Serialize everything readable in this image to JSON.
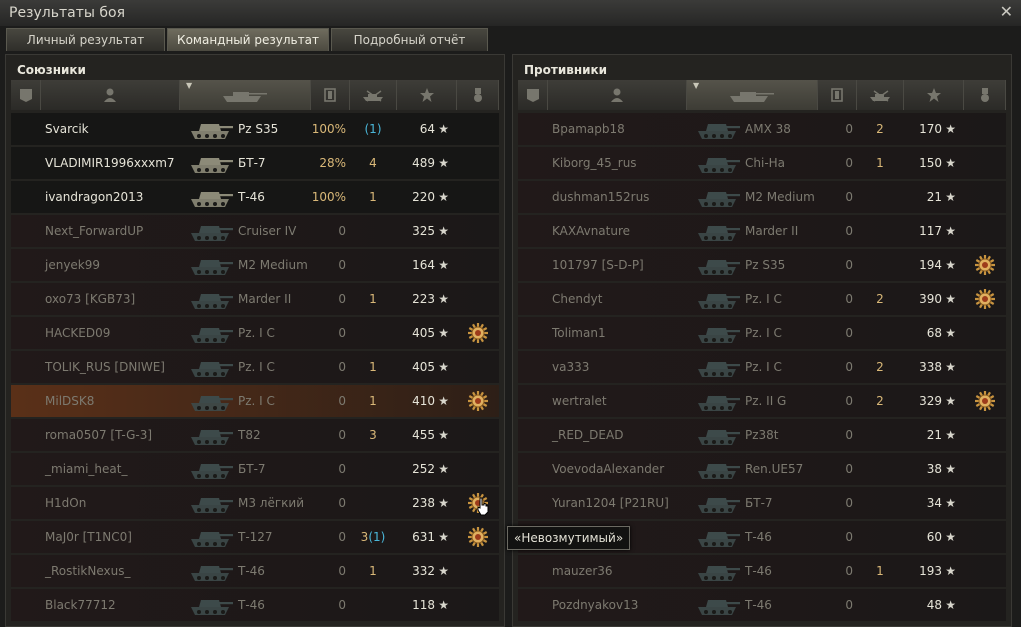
{
  "window": {
    "title": "Результаты боя",
    "close_icon": "close-icon"
  },
  "tabs": [
    {
      "label": "Личный результат",
      "active": false
    },
    {
      "label": "Командный результат",
      "active": true
    },
    {
      "label": "Подробный отчёт",
      "active": false
    }
  ],
  "columns": [
    "squad-icon",
    "player-icon",
    "tank-icon",
    "damage-icon",
    "kills-icon",
    "xp-icon",
    "medal-icon"
  ],
  "allies": {
    "title": "Союзники",
    "rows": [
      {
        "name": "Svarcik",
        "tank": "Pz S35",
        "dmg": "100%",
        "kills_main": "",
        "kills_blue": "(1)",
        "xp": "64",
        "medal": false,
        "state": "alive",
        "dmg_hi": true
      },
      {
        "name": "VLADIMIR1996xxxm7",
        "tank": "БТ-7",
        "dmg": "28%",
        "kills_main": "4",
        "kills_blue": "",
        "xp": "489",
        "medal": false,
        "state": "alive",
        "dmg_hi": true
      },
      {
        "name": "ivandragon2013",
        "tank": "Т-46",
        "dmg": "100%",
        "kills_main": "1",
        "kills_blue": "",
        "xp": "220",
        "medal": false,
        "state": "alive",
        "dmg_hi": true
      },
      {
        "name": "Next_ForwardUP",
        "tank": "Cruiser IV",
        "dmg": "0",
        "kills_main": "",
        "kills_blue": "",
        "xp": "325",
        "medal": false,
        "state": "dead"
      },
      {
        "name": "jenyek99",
        "tank": "M2 Medium",
        "dmg": "0",
        "kills_main": "",
        "kills_blue": "",
        "xp": "164",
        "medal": false,
        "state": "dead"
      },
      {
        "name": "oxo73 [KGB73]",
        "tank": "Marder II",
        "dmg": "0",
        "kills_main": "1",
        "kills_blue": "",
        "xp": "223",
        "medal": false,
        "state": "dead"
      },
      {
        "name": "HACKED09",
        "tank": "Pz. I C",
        "dmg": "0",
        "kills_main": "",
        "kills_blue": "",
        "xp": "405",
        "medal": true,
        "state": "dead"
      },
      {
        "name": "TOLIK_RUS [DNIWE]",
        "tank": "Pz. I C",
        "dmg": "0",
        "kills_main": "1",
        "kills_blue": "",
        "xp": "405",
        "medal": false,
        "state": "dead"
      },
      {
        "name": "MilDSK8",
        "tank": "Pz. I C",
        "dmg": "0",
        "kills_main": "1",
        "kills_blue": "",
        "xp": "410",
        "medal": true,
        "state": "self"
      },
      {
        "name": "roma0507 [T-G-3]",
        "tank": "T82",
        "dmg": "0",
        "kills_main": "3",
        "kills_blue": "",
        "xp": "455",
        "medal": false,
        "state": "dead"
      },
      {
        "name": "_miami_heat_",
        "tank": "БТ-7",
        "dmg": "0",
        "kills_main": "",
        "kills_blue": "",
        "xp": "252",
        "medal": false,
        "state": "dead"
      },
      {
        "name": "H1dOn",
        "tank": "М3 лёгкий",
        "dmg": "0",
        "kills_main": "",
        "kills_blue": "",
        "xp": "238",
        "medal": true,
        "state": "dead"
      },
      {
        "name": "MaJ0r [T1NC0]",
        "tank": "Т-127",
        "dmg": "0",
        "kills_main": "3",
        "kills_blue": "(1)",
        "xp": "631",
        "medal": true,
        "state": "dead"
      },
      {
        "name": "_RostikNexus_",
        "tank": "Т-46",
        "dmg": "0",
        "kills_main": "1",
        "kills_blue": "",
        "xp": "332",
        "medal": false,
        "state": "dead"
      },
      {
        "name": "Black77712",
        "tank": "Т-46",
        "dmg": "0",
        "kills_main": "",
        "kills_blue": "",
        "xp": "118",
        "medal": false,
        "state": "dead"
      }
    ]
  },
  "enemies": {
    "title": "Противники",
    "rows": [
      {
        "name": "Bpamapb18",
        "tank": "AMX 38",
        "dmg": "0",
        "kills_main": "2",
        "kills_blue": "",
        "xp": "170",
        "medal": false,
        "state": "dead"
      },
      {
        "name": "Kiborg_45_rus",
        "tank": "Chi-Ha",
        "dmg": "0",
        "kills_main": "1",
        "kills_blue": "",
        "xp": "150",
        "medal": false,
        "state": "dead"
      },
      {
        "name": "dushman152rus",
        "tank": "M2 Medium",
        "dmg": "0",
        "kills_main": "",
        "kills_blue": "",
        "xp": "21",
        "medal": false,
        "state": "dead"
      },
      {
        "name": "KAXAvnature",
        "tank": "Marder II",
        "dmg": "0",
        "kills_main": "",
        "kills_blue": "",
        "xp": "117",
        "medal": false,
        "state": "dead"
      },
      {
        "name": "101797 [S-D-P]",
        "tank": "Pz S35",
        "dmg": "0",
        "kills_main": "",
        "kills_blue": "",
        "xp": "194",
        "medal": true,
        "state": "dead"
      },
      {
        "name": "Chendyt",
        "tank": "Pz. I C",
        "dmg": "0",
        "kills_main": "2",
        "kills_blue": "",
        "xp": "390",
        "medal": true,
        "state": "dead"
      },
      {
        "name": "Toliman1",
        "tank": "Pz. I C",
        "dmg": "0",
        "kills_main": "",
        "kills_blue": "",
        "xp": "68",
        "medal": false,
        "state": "dead"
      },
      {
        "name": "va333",
        "tank": "Pz. I C",
        "dmg": "0",
        "kills_main": "2",
        "kills_blue": "",
        "xp": "338",
        "medal": false,
        "state": "dead"
      },
      {
        "name": "wertralet",
        "tank": "Pz. II G",
        "dmg": "0",
        "kills_main": "2",
        "kills_blue": "",
        "xp": "329",
        "medal": true,
        "state": "dead"
      },
      {
        "name": "_RED_DEAD",
        "tank": "Pz38t",
        "dmg": "0",
        "kills_main": "",
        "kills_blue": "",
        "xp": "21",
        "medal": false,
        "state": "dead"
      },
      {
        "name": "VoevodaAlexander",
        "tank": "Ren.UE57",
        "dmg": "0",
        "kills_main": "",
        "kills_blue": "",
        "xp": "38",
        "medal": false,
        "state": "dead"
      },
      {
        "name": "Yuran1204 [P21RU]",
        "tank": "БТ-7",
        "dmg": "0",
        "kills_main": "",
        "kills_blue": "",
        "xp": "34",
        "medal": false,
        "state": "dead"
      },
      {
        "name": "",
        "tank": "Т-46",
        "dmg": "0",
        "kills_main": "",
        "kills_blue": "",
        "xp": "60",
        "medal": false,
        "state": "dead"
      },
      {
        "name": "mauzer36",
        "tank": "Т-46",
        "dmg": "0",
        "kills_main": "1",
        "kills_blue": "",
        "xp": "193",
        "medal": false,
        "state": "dead"
      },
      {
        "name": "Pozdnyakov13",
        "tank": "Т-46",
        "dmg": "0",
        "kills_main": "",
        "kills_blue": "",
        "xp": "48",
        "medal": false,
        "state": "dead"
      }
    ]
  },
  "tooltip": {
    "text": "«Невозмутимый»"
  },
  "colors": {
    "accent": "#d9b878",
    "blue": "#4ab6d8",
    "self_row": "#5a3018"
  }
}
